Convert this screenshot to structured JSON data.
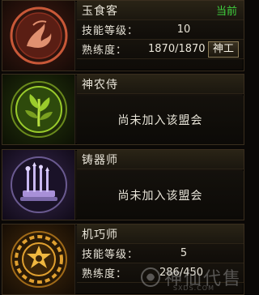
{
  "professions": [
    {
      "name": "玉食客",
      "status": "当前",
      "skill_label": "技能等级：",
      "skill_value": "10",
      "proficiency_label": "熟练度：",
      "proficiency_value": "1870/1870",
      "rank_button": "神工",
      "emblem_icon": "dragon-emblem-icon",
      "color": "#c85838"
    },
    {
      "name": "神农侍",
      "message": "尚未加入该盟会",
      "emblem_icon": "herb-emblem-icon",
      "color": "#9acb2c"
    },
    {
      "name": "铸器师",
      "message": "尚未加入该盟会",
      "emblem_icon": "weapon-rack-emblem-icon",
      "color": "#a890d8"
    },
    {
      "name": "机巧师",
      "skill_label": "技能等级：",
      "skill_value": "5",
      "proficiency_label": "熟练度：",
      "proficiency_value": "286/450",
      "emblem_icon": "gear-emblem-icon",
      "color": "#e0a030"
    }
  ],
  "watermark": {
    "text": "神仙代售",
    "url": "SXDS.COM"
  }
}
